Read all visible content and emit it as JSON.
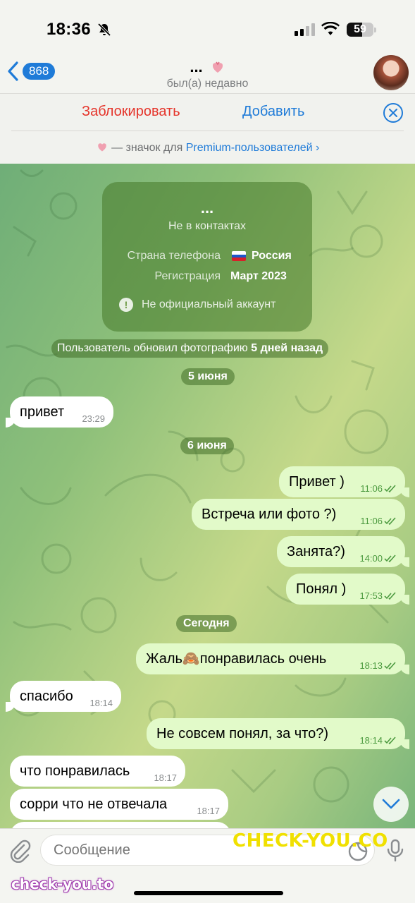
{
  "status": {
    "time": "18:36",
    "battery": "59",
    "battery_level": 0.59
  },
  "header": {
    "back_count": "868",
    "name": "...",
    "last_seen": "был(а) недавно",
    "avatar_icon": "avatar"
  },
  "actions": {
    "block": "Заблокировать",
    "add": "Добавить",
    "premium_text": "— значок для",
    "premium_link": "Premium-пользователей"
  },
  "info_card": {
    "name": "...",
    "status": "Не в контактах",
    "country_label": "Страна телефона",
    "country_value": "Россия",
    "reg_label": "Регистрация",
    "reg_value": "Март 2023",
    "warning": "Не официальный аккаунт"
  },
  "service_message": {
    "text": "Пользователь обновил фотографию",
    "bold": "5 дней назад"
  },
  "dates": {
    "d1": "5 июня",
    "d2": "6 июня",
    "d3": "Сегодня"
  },
  "messages": [
    {
      "text": "привет",
      "time": "23:29",
      "dir": "in"
    },
    {
      "text": "Привет )",
      "time": "11:06",
      "dir": "out"
    },
    {
      "text": "Встреча или фото ?)",
      "time": "11:06",
      "dir": "out"
    },
    {
      "text": "Занята?)",
      "time": "14:00",
      "dir": "out"
    },
    {
      "text": "Понял )",
      "time": "17:53",
      "dir": "out"
    },
    {
      "text": "Жаль🙈понравилась очень",
      "time": "18:13",
      "dir": "out"
    },
    {
      "text": "спасибо",
      "time": "18:14",
      "dir": "in"
    },
    {
      "text": "Не совсем понял, за что?)",
      "time": "18:14",
      "dir": "out"
    },
    {
      "text": "что понравилась",
      "time": "18:17",
      "dir": "in"
    },
    {
      "text": "сорри что не отвечала",
      "time": "18:17",
      "dir": "in"
    }
  ],
  "input": {
    "placeholder": "Сообщение"
  },
  "watermarks": {
    "right": "CHECK-YOU.CO",
    "left": "check-you.to"
  },
  "colors": {
    "accent": "#1f7bd8",
    "danger": "#e5342a",
    "out_bubble": "#e2fac9",
    "check_green": "#4c9a3f"
  }
}
